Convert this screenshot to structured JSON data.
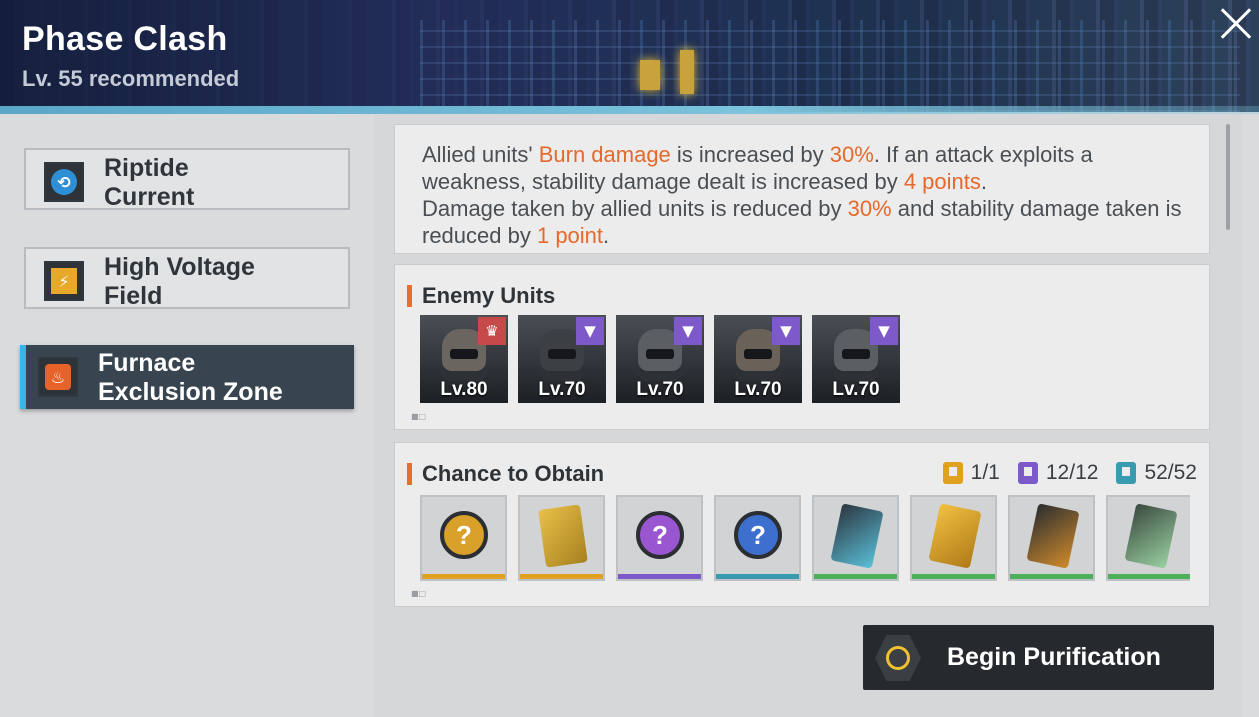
{
  "header": {
    "title": "Phase Clash",
    "subtitle": "Lv. 55 recommended",
    "close_icon": "close-icon"
  },
  "sidebar": {
    "items": [
      {
        "label_line1": "Riptide",
        "label_line2": "Current",
        "icon": "riptide-icon",
        "icon_color": "#2f8fd6",
        "active": false
      },
      {
        "label_line1": "High Voltage",
        "label_line2": "Field",
        "icon": "lightning-icon",
        "icon_color": "#e8a92a",
        "active": false
      },
      {
        "label_line1": "Furnace",
        "label_line2": "Exclusion Zone",
        "icon": "flame-icon",
        "icon_color": "#e8632a",
        "active": true
      }
    ]
  },
  "effect": {
    "p1_a": "Allied units' ",
    "p1_b": "Burn damage",
    "p1_c": " is increased by ",
    "p1_d": "30%",
    "p1_e": ". If an attack exploits a weakness, stability damage dealt is increased by ",
    "p1_f": "4 points",
    "p1_g": ".",
    "p2_a": "Damage taken by allied units is reduced by ",
    "p2_b": "30%",
    "p2_c": " and stability damage taken is reduced by ",
    "p2_d": "1 point",
    "p2_e": "."
  },
  "enemies": {
    "title": "Enemy Units",
    "units": [
      {
        "level": "Lv.80",
        "badge_color": "#c64a4a"
      },
      {
        "level": "Lv.70",
        "badge_color": "#7d59c9"
      },
      {
        "level": "Lv.70",
        "badge_color": "#7d59c9"
      },
      {
        "level": "Lv.70",
        "badge_color": "#7d59c9"
      },
      {
        "level": "Lv.70",
        "badge_color": "#7d59c9"
      }
    ]
  },
  "drops": {
    "title": "Chance to Obtain",
    "counts": [
      {
        "value": "1/1",
        "color": "#e0a020"
      },
      {
        "value": "12/12",
        "color": "#7d59c9"
      },
      {
        "value": "52/52",
        "color": "#3a9ab0"
      }
    ],
    "items": [
      {
        "icon": "mystery-orb-gold-icon",
        "rarity_color": "#e0a020"
      },
      {
        "icon": "gold-chip-icon",
        "rarity_color": "#e0a020"
      },
      {
        "icon": "mystery-orb-purple-icon",
        "rarity_color": "#7d59c9"
      },
      {
        "icon": "mystery-orb-blue-icon",
        "rarity_color": "#3a9ab0"
      },
      {
        "icon": "dna-card-icon",
        "rarity_color": "#4caf5a"
      },
      {
        "icon": "gold-card-icon",
        "rarity_color": "#4caf5a"
      },
      {
        "icon": "battery-icon",
        "rarity_color": "#4caf5a"
      },
      {
        "icon": "circuit-card-icon",
        "rarity_color": "#4caf5a"
      }
    ]
  },
  "action": {
    "label": "Begin Purification"
  }
}
